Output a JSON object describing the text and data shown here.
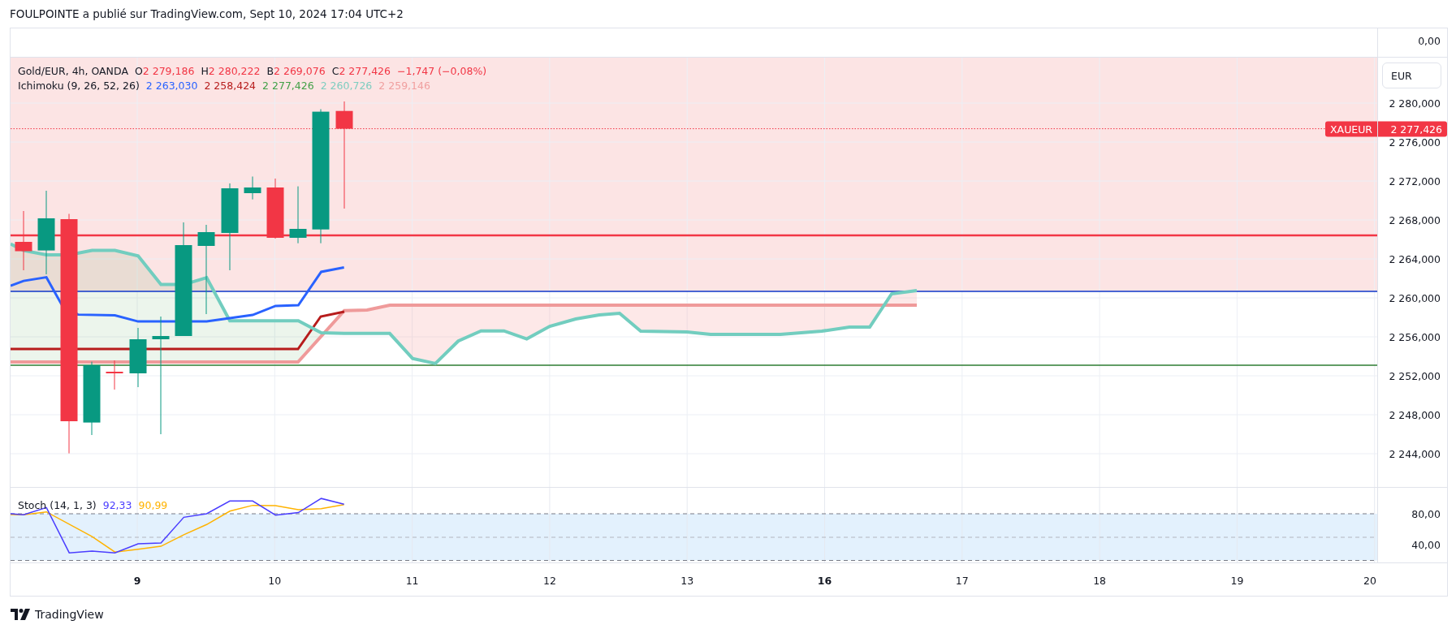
{
  "header": {
    "text": "FOULPOINTE a publié sur TradingView.com, Sept 10, 2024 17:04 UTC+2"
  },
  "top_pane": {
    "axis_label": "0,00"
  },
  "legend": {
    "symbol": "Gold/EUR, 4h, OANDA",
    "ohlc": [
      {
        "label": "O",
        "value": "2 279,186"
      },
      {
        "label": "H",
        "value": "2 280,222"
      },
      {
        "label": "B",
        "value": "2 269,076"
      },
      {
        "label": "C",
        "value": "2 277,426"
      }
    ],
    "change": "−1,747 (−0,08%)"
  },
  "ichimoku": {
    "name": "Ichimoku (9, 26, 52, 26)",
    "values": [
      {
        "value": "2 263,030",
        "color": "#2962ff"
      },
      {
        "value": "2 258,424",
        "color": "#b71c1c"
      },
      {
        "value": "2 277,426",
        "color": "#43a047"
      },
      {
        "value": "2 260,726",
        "color": "#7ecdc0"
      },
      {
        "value": "2 259,146",
        "color": "#f0a0a0"
      }
    ]
  },
  "currency_button": "EUR",
  "price_axis": [
    "2 280,000",
    "2 276,000",
    "2 272,000",
    "2 268,000",
    "2 264,000",
    "2 260,000",
    "2 256,000",
    "2 252,000",
    "2 248,000",
    "2 244,000"
  ],
  "last_price": {
    "symbol": "XAUEUR",
    "value": "2 277,426"
  },
  "stoch": {
    "name": "Stoch (14, 1, 3)",
    "values": [
      {
        "value": "92,33",
        "color": "#4a3dff"
      },
      {
        "value": "90,99",
        "color": "#ffb300"
      }
    ],
    "axis": [
      "80,00",
      "40,00"
    ]
  },
  "time_axis": [
    {
      "label": "9",
      "kind": "week"
    },
    {
      "label": "10",
      "kind": "day"
    },
    {
      "label": "11",
      "kind": "day"
    },
    {
      "label": "12",
      "kind": "day"
    },
    {
      "label": "13",
      "kind": "day"
    },
    {
      "label": "16",
      "kind": "week"
    },
    {
      "label": "17",
      "kind": "day"
    },
    {
      "label": "18",
      "kind": "day"
    },
    {
      "label": "19",
      "kind": "day"
    },
    {
      "label": "20",
      "kind": "day"
    }
  ],
  "footer": {
    "brand": "TradingView"
  }
}
